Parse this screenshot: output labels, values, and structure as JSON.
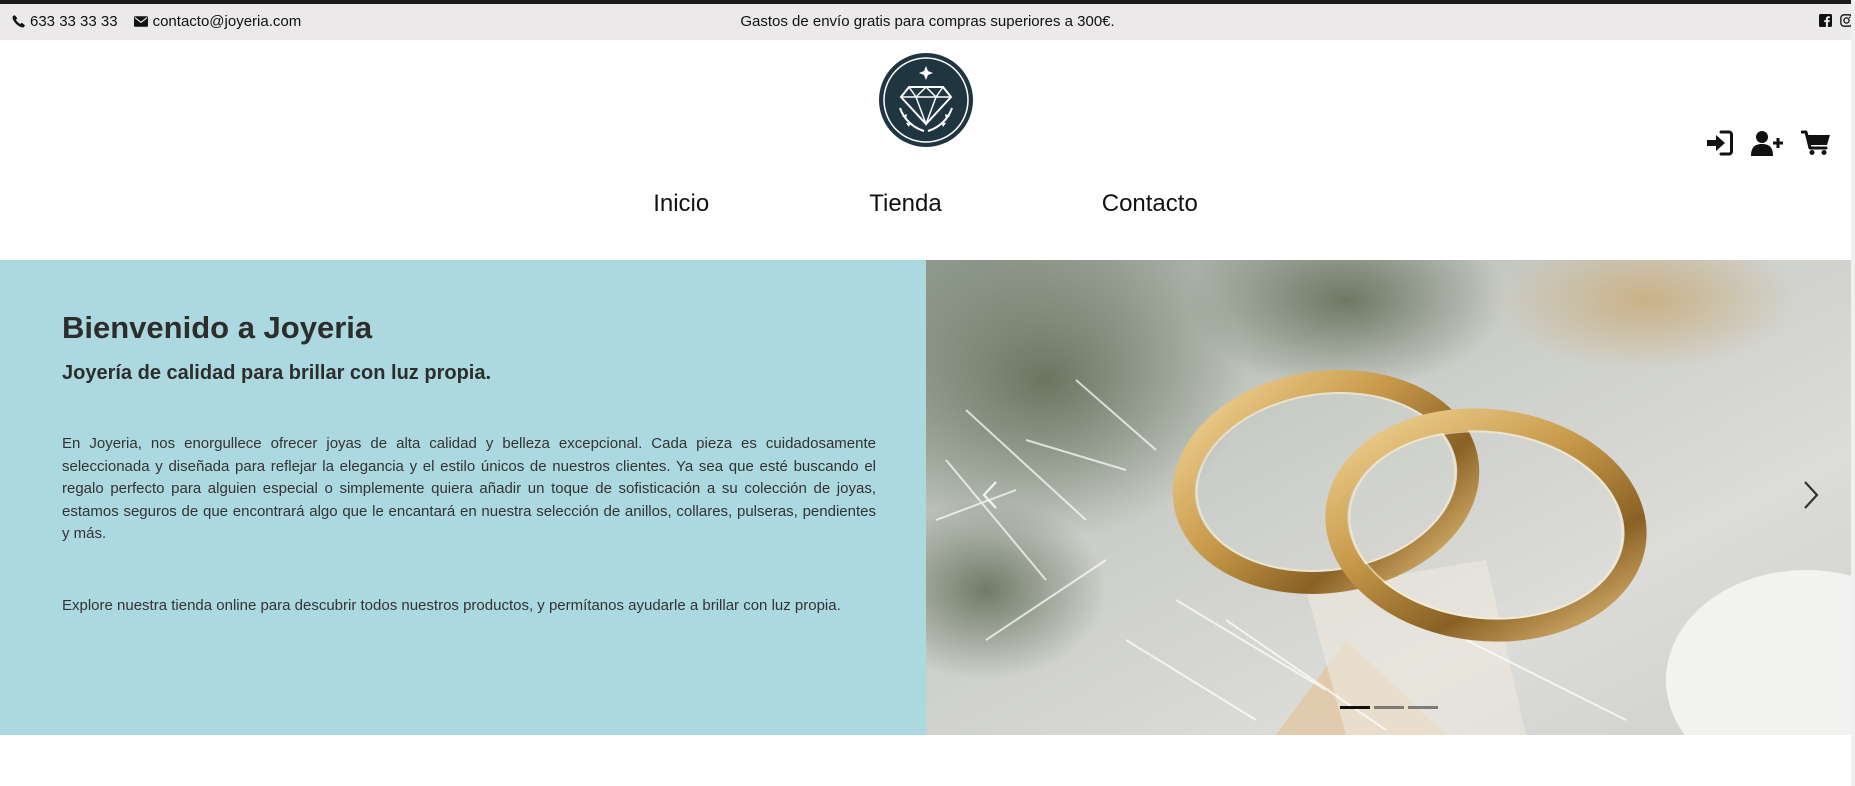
{
  "topbar": {
    "phone": "633 33 33 33",
    "email": "contacto@joyeria.com",
    "promo": "Gastos de envío gratis para compras superiores a 300€.",
    "social_icons": [
      "facebook-icon",
      "instagram-icon"
    ]
  },
  "header": {
    "logo_icon": "diamond-logo",
    "nav": [
      "Inicio",
      "Tienda",
      "Contacto"
    ],
    "account_icons": [
      "sign-in-icon",
      "user-plus-icon",
      "shopping-cart-icon"
    ]
  },
  "hero": {
    "title": "Bienvenido a Joyeria",
    "subtitle": "Joyería de calidad para brillar con luz propia.",
    "paragraph1": "En Joyeria, nos enorgullece ofrecer joyas de alta calidad y belleza excepcional. Cada pieza es cuidadosamente seleccionada y diseñada para reflejar la elegancia y el estilo únicos de nuestros clientes. Ya sea que esté buscando el regalo perfecto para alguien especial o simplemente quiera añadir un toque de sofisticación a su colección de joyas, estamos seguros de que encontrará algo que le encantará en nuestra selección de anillos, collares, pulseras, pendientes y más.",
    "paragraph2": "Explore nuestra tienda online para descubrir todos nuestros productos, y permítanos ayudarle a brillar con luz propia.",
    "carousel": {
      "slide_count": 3,
      "active_slide": 1,
      "image": "wedding-rings-photo"
    }
  },
  "colors": {
    "hero_background": "#acd8df",
    "topbar_background": "#ebe9ea",
    "logo_dark": "#1f3540",
    "text_dark": "#2d2d2d"
  }
}
